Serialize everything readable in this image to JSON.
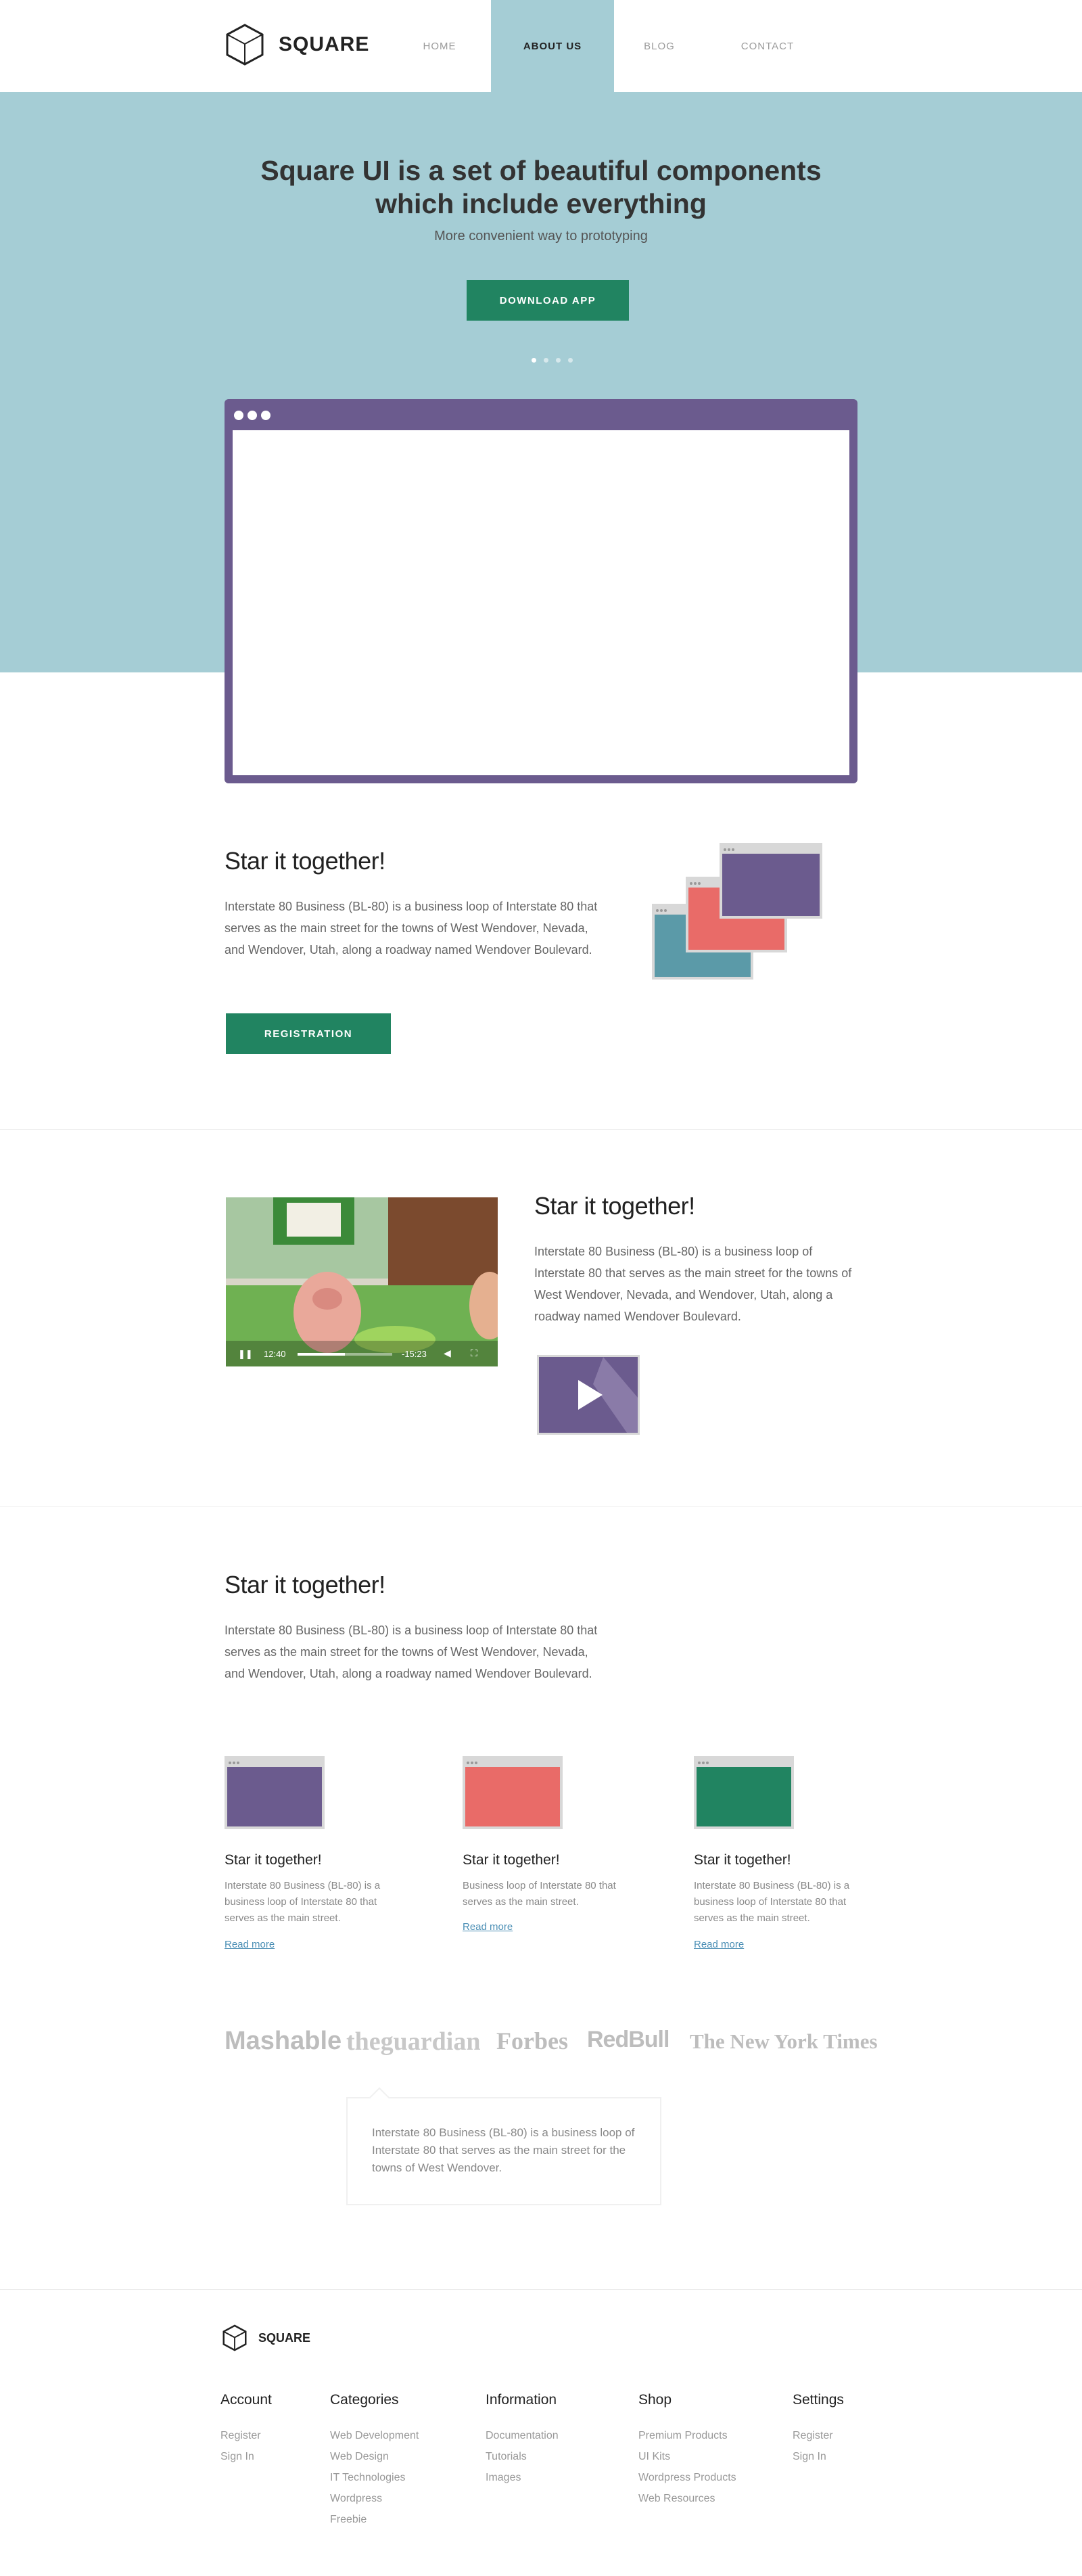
{
  "header": {
    "logo_text": "SQUARE",
    "nav": [
      {
        "label": "HOME"
      },
      {
        "label": "ABOUT US"
      },
      {
        "label": "BLOG"
      },
      {
        "label": "CONTACT"
      }
    ]
  },
  "hero": {
    "title": "Square UI is a set of beautiful components which include everything",
    "subtitle": "More convenient way to prototyping",
    "button": "DOWNLOAD APP"
  },
  "section1": {
    "title": "Star it together!",
    "text": "Interstate 80 Business (BL-80) is a business loop of Interstate 80 that serves as the main street for the towns of West Wendover, Nevada, and Wendover, Utah, along a roadway named Wendover Boulevard.",
    "button": "REGISTRATION"
  },
  "section2": {
    "title": "Star it together!",
    "text": "Interstate 80 Business (BL-80) is a business loop of Interstate 80 that serves as the main street for the towns of West Wendover, Nevada, and Wendover, Utah, along a roadway named Wendover Boulevard.",
    "video": {
      "elapsed": "12:40",
      "remaining": "-15:23",
      "progress": 0.5
    }
  },
  "section3": {
    "title": "Star it together!",
    "text": "Interstate 80 Business (BL-80) is a business loop of Interstate 80 that serves as the main street for the towns of West Wendover, Nevada, and Wendover, Utah, along a roadway named Wendover Boulevard.",
    "cards": [
      {
        "title": "Star it together!",
        "text": "Interstate 80 Business (BL-80) is a business loop of Interstate 80 that serves as the main street.",
        "link": "Read more",
        "color": "#6b5b8e"
      },
      {
        "title": "Star it together!",
        "text": "Business loop of Interstate 80 that serves as the main street.",
        "link": "Read more",
        "color": "#e96b68"
      },
      {
        "title": "Star it together!",
        "text": "Interstate 80 Business (BL-80) is a business loop of Interstate 80 that serves as the main street.",
        "link": "Read more",
        "color": "#218461"
      }
    ]
  },
  "brands": [
    "Mashable",
    "theguardian",
    "Forbes",
    "RedBull",
    "The New York Times"
  ],
  "quote": "Interstate 80 Business (BL-80) is a business loop of Interstate 80 that serves as the main street for the towns of West Wendover.",
  "footer": {
    "logo_text": "SQUARE",
    "columns": [
      {
        "title": "Account",
        "links": [
          "Register",
          "Sign In"
        ]
      },
      {
        "title": "Categories",
        "links": [
          "Web Development",
          "Web Design",
          "IT Technologies",
          "Wordpress",
          "Freebie"
        ]
      },
      {
        "title": "Information",
        "links": [
          "Documentation",
          "Tutorials",
          "Images"
        ]
      },
      {
        "title": "Shop",
        "links": [
          "Premium Products",
          "UI Kits",
          "Wordpress Products",
          "Web Resources"
        ]
      },
      {
        "title": "Settings",
        "links": [
          "Register",
          "Sign In"
        ]
      }
    ]
  },
  "colors": {
    "hero_bg": "#a5cdd5",
    "accent_green": "#218461",
    "purple": "#6b5b8e",
    "coral": "#e96b68",
    "teal": "#5b9aa8"
  }
}
